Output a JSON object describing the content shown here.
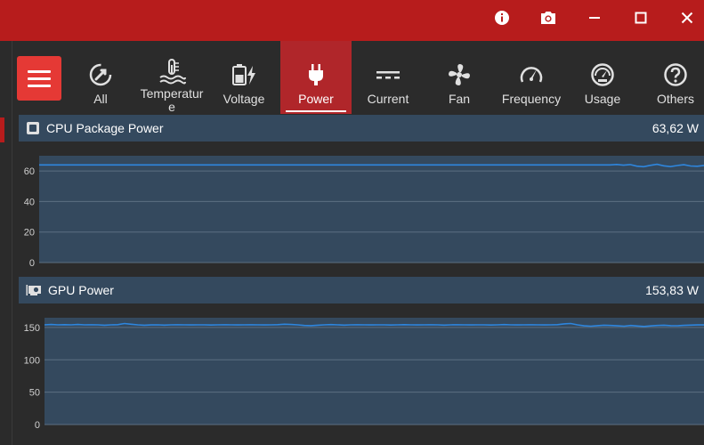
{
  "titlebar": {
    "buttons": [
      {
        "name": "info-icon",
        "glyph": "i"
      },
      {
        "name": "camera-icon"
      },
      {
        "name": "minimize-icon"
      },
      {
        "name": "maximize-icon"
      },
      {
        "name": "close-icon"
      }
    ]
  },
  "nav": {
    "tabs": [
      {
        "label": "All",
        "icon": "all-icon"
      },
      {
        "label": "Temperatur\ne",
        "icon": "temperature-icon"
      },
      {
        "label": "Voltage",
        "icon": "battery-icon"
      },
      {
        "label": "Power",
        "icon": "plug-icon",
        "active": true
      },
      {
        "label": "Current",
        "icon": "current-icon"
      },
      {
        "label": "Fan",
        "icon": "fan-icon"
      },
      {
        "label": "Frequency",
        "icon": "gauge-icon"
      },
      {
        "label": "Usage",
        "icon": "usage-icon"
      },
      {
        "label": "Others",
        "icon": "question-icon"
      }
    ]
  },
  "panels": [
    {
      "title": "CPU Package Power",
      "value": "63,62 W",
      "icon": "cpu-icon"
    },
    {
      "title": "GPU Power",
      "value": "153,83 W",
      "icon": "gpu-icon"
    }
  ],
  "colors": {
    "titlebar": "#b71c1c",
    "accent": "#e53935",
    "active_tab": "#b0262a",
    "panel_header": "#34495e",
    "plot_bg": "#34495e",
    "line": "#2e86de"
  },
  "chart_data": [
    {
      "type": "line",
      "title": "CPU Package Power",
      "ylim": [
        0,
        70
      ],
      "yticks": [
        0,
        20,
        40,
        60
      ],
      "grid": true,
      "series": [
        {
          "values": [
            64,
            64,
            64,
            64,
            64,
            64,
            64,
            64,
            64,
            64,
            64,
            64,
            64,
            64,
            64,
            64,
            64,
            64,
            64,
            64,
            64,
            64,
            64,
            64,
            64,
            64,
            64,
            64,
            64,
            64,
            64,
            64,
            64,
            64,
            64,
            64,
            64,
            64,
            64,
            64,
            64,
            64,
            64,
            64,
            64,
            64,
            64,
            64,
            64,
            64,
            64,
            64,
            64,
            64,
            64,
            64,
            64,
            64,
            64,
            64,
            64,
            64,
            64,
            64,
            64,
            64,
            64,
            64,
            64,
            64,
            64,
            64,
            64,
            64,
            64,
            64,
            64,
            64,
            64,
            64,
            64,
            64,
            64,
            64,
            64,
            64,
            64.3,
            63.8,
            64.2,
            63.2,
            62.8,
            63.7,
            64.4,
            63.4,
            62.9,
            63.6,
            64.1,
            63.3,
            63.1,
            63.62
          ]
        }
      ]
    },
    {
      "type": "line",
      "title": "GPU Power",
      "ylim": [
        0,
        165
      ],
      "yticks": [
        0,
        50,
        100,
        150
      ],
      "grid": true,
      "series": [
        {
          "values": [
            154,
            154.5,
            154,
            154.3,
            154,
            154.5,
            154,
            154.2,
            154,
            153.5,
            154,
            154.3,
            156,
            155,
            154,
            153.5,
            153.8,
            154,
            153.6,
            154,
            154.2,
            154,
            153.8,
            154,
            154,
            153.7,
            154,
            154.2,
            154,
            153.8,
            154,
            154.1,
            154,
            153.9,
            154,
            154.3,
            155,
            154.5,
            154,
            153,
            152.8,
            153.5,
            154,
            154.4,
            154,
            153.6,
            154,
            154.2,
            154,
            153.8,
            154,
            154,
            153.7,
            154,
            154.3,
            154,
            153.9,
            154,
            154.1,
            154,
            153.6,
            154,
            154.2,
            154,
            153.8,
            154,
            154,
            153.7,
            154,
            154.4,
            154,
            153.8,
            154,
            154.2,
            154,
            153.9,
            154,
            154.3,
            155.5,
            156,
            154,
            152.5,
            152,
            152.8,
            153.5,
            153,
            152.5,
            152,
            153,
            152.2,
            151.5,
            152.4,
            153,
            153.5,
            152.8,
            152.6,
            153.2,
            153.6,
            153.9,
            153.83
          ]
        }
      ]
    }
  ]
}
